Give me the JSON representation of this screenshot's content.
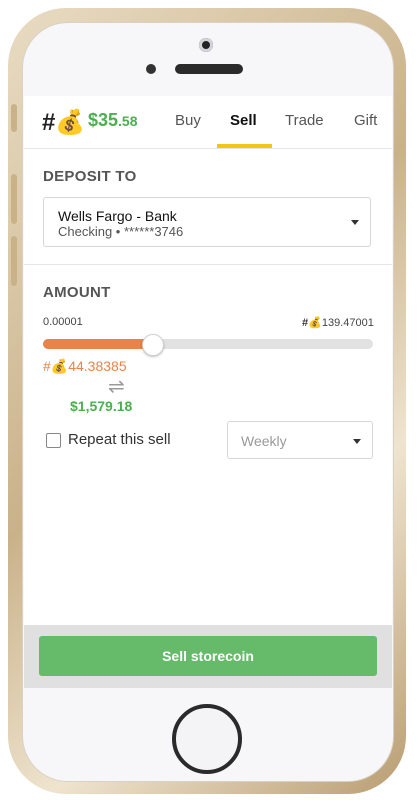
{
  "header": {
    "logo": "#💰",
    "balance_whole": "$35",
    "balance_cents": ".58",
    "tabs": [
      {
        "label": "Buy",
        "active": false
      },
      {
        "label": "Sell",
        "active": true
      },
      {
        "label": "Trade",
        "active": false
      },
      {
        "label": "Gift",
        "active": false
      }
    ]
  },
  "deposit": {
    "title": "DEPOSIT TO",
    "account_name": "Wells Fargo - Bank",
    "account_detail": "Checking • ******3746"
  },
  "amount": {
    "title": "AMOUNT",
    "min": "0.00001",
    "max_symbol": "#💰",
    "max": "139.47001",
    "slider_fraction": 0.33,
    "coin_value": "#💰44.38385",
    "usd_value": "$1,579.18"
  },
  "repeat": {
    "label": "Repeat this sell",
    "checked": false,
    "frequency": "Weekly"
  },
  "action": {
    "label": "Sell storecoin"
  },
  "colors": {
    "accent_orange": "#e8844a",
    "green": "#4caf50",
    "button_green": "#66bb6a",
    "tab_underline": "#f3c614"
  }
}
